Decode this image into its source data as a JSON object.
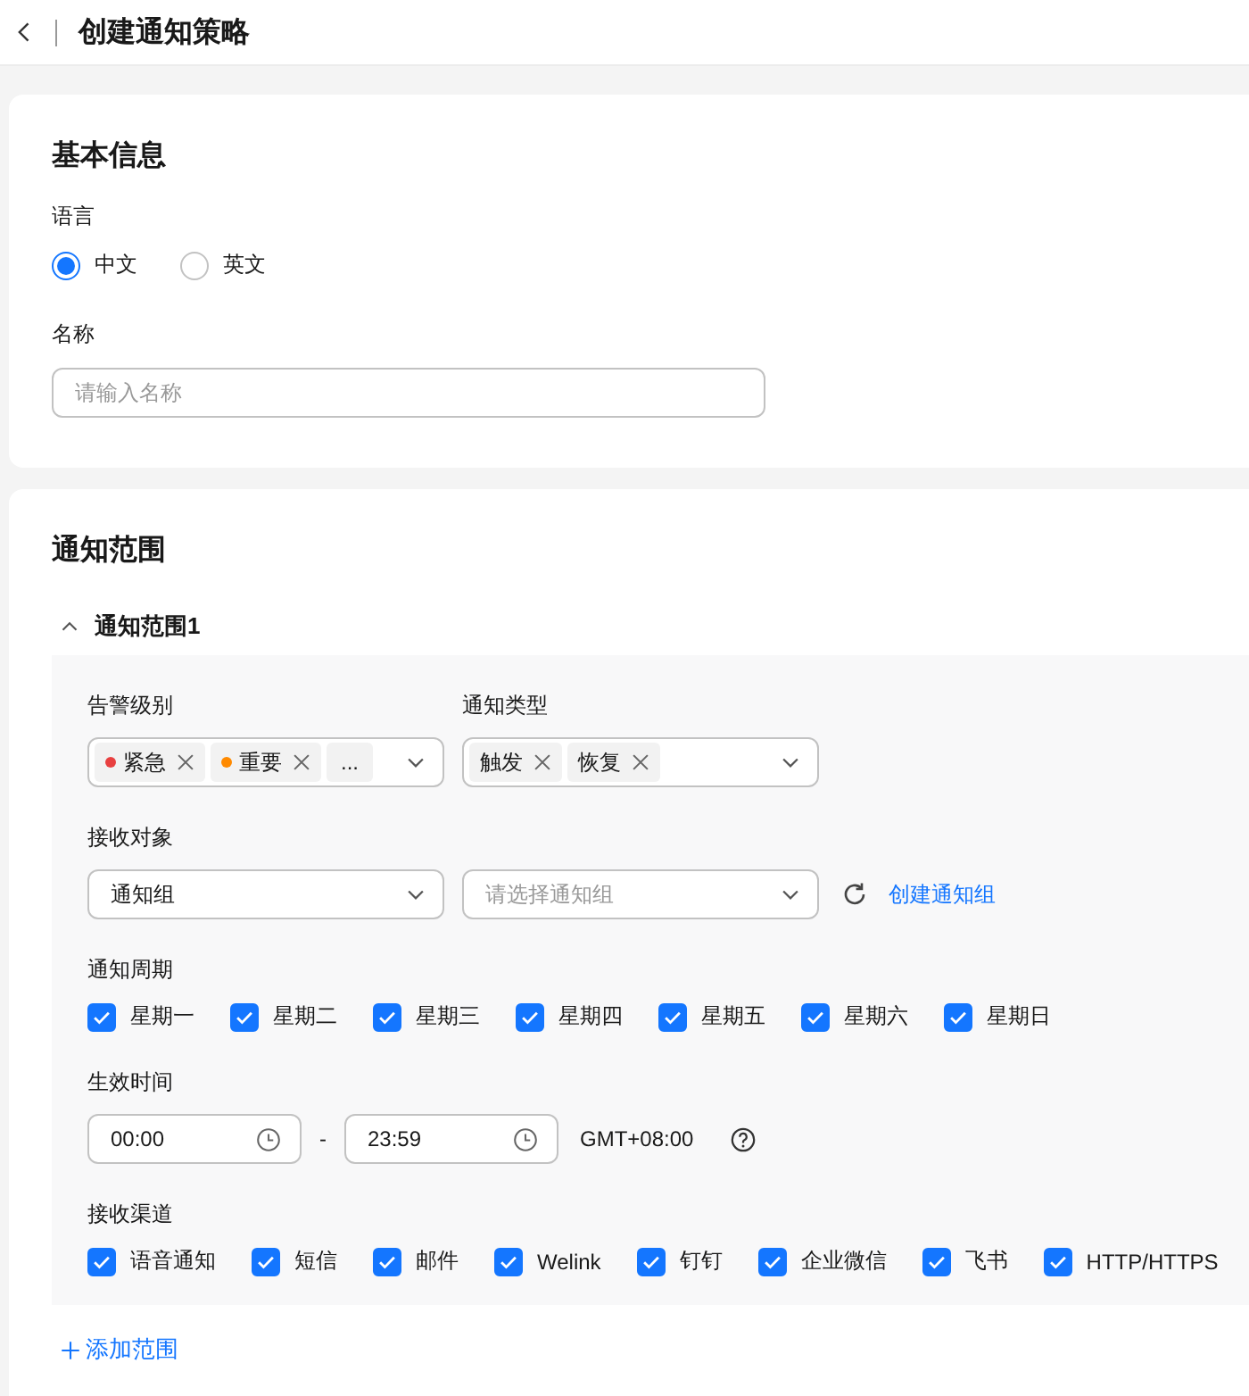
{
  "header": {
    "title": "创建通知策略"
  },
  "basic_info": {
    "title": "基本信息",
    "language": {
      "label": "语言",
      "options": [
        {
          "label": "中文",
          "selected": true
        },
        {
          "label": "英文",
          "selected": false
        }
      ]
    },
    "name": {
      "label": "名称",
      "placeholder": "请输入名称"
    }
  },
  "scope": {
    "title": "通知范围",
    "sections": [
      {
        "title": "通知范围1",
        "expanded": true,
        "alarm_level": {
          "label": "告警级别",
          "tags": [
            {
              "label": "紧急",
              "color": "#e84040"
            },
            {
              "label": "重要",
              "color": "#ff8a00"
            }
          ],
          "more": "..."
        },
        "notify_type": {
          "label": "通知类型",
          "tags": [
            {
              "label": "触发"
            },
            {
              "label": "恢复"
            }
          ]
        },
        "recipients": {
          "label": "接收对象",
          "type_value": "通知组",
          "group_placeholder": "请选择通知组",
          "create_link": "创建通知组"
        },
        "period": {
          "label": "通知周期",
          "days": [
            {
              "label": "星期一",
              "checked": true
            },
            {
              "label": "星期二",
              "checked": true
            },
            {
              "label": "星期三",
              "checked": true
            },
            {
              "label": "星期四",
              "checked": true
            },
            {
              "label": "星期五",
              "checked": true
            },
            {
              "label": "星期六",
              "checked": true
            },
            {
              "label": "星期日",
              "checked": true
            }
          ]
        },
        "effective_time": {
          "label": "生效时间",
          "start": "00:00",
          "separator": "-",
          "end": "23:59",
          "timezone": "GMT+08:00"
        },
        "channels": {
          "label": "接收渠道",
          "items": [
            {
              "label": "语音通知",
              "checked": true
            },
            {
              "label": "短信",
              "checked": true
            },
            {
              "label": "邮件",
              "checked": true
            },
            {
              "label": "Welink",
              "checked": true
            },
            {
              "label": "钉钉",
              "checked": true
            },
            {
              "label": "企业微信",
              "checked": true
            },
            {
              "label": "飞书",
              "checked": true
            },
            {
              "label": "HTTP/HTTPS",
              "checked": true
            }
          ]
        }
      }
    ],
    "add_scope": "添加范围"
  }
}
